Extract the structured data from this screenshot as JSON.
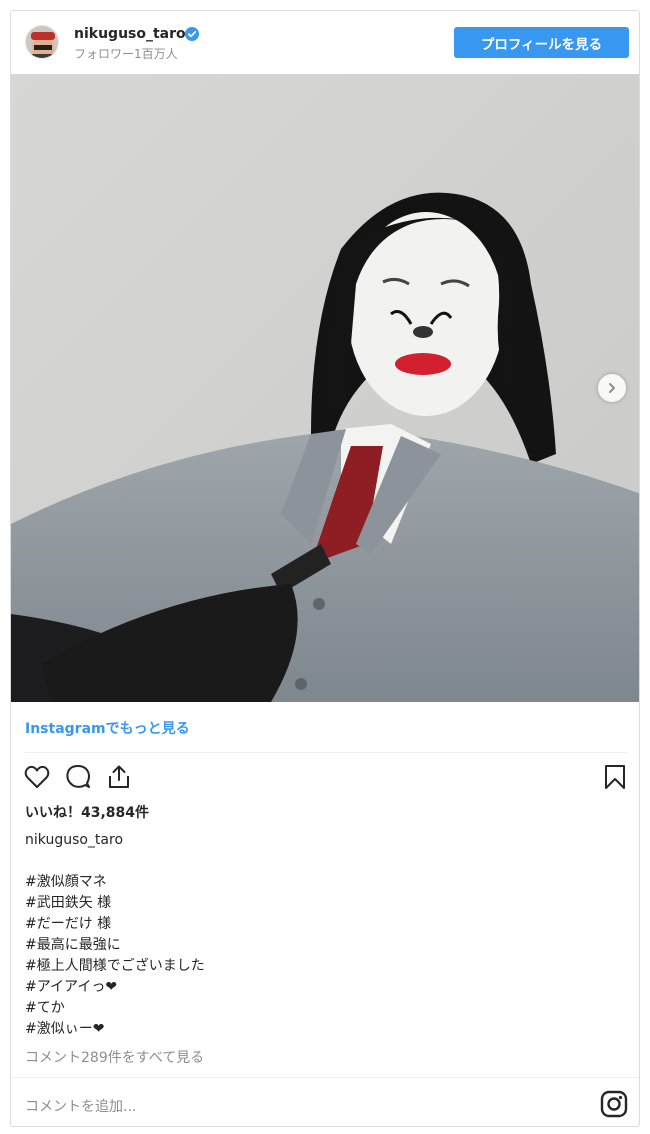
{
  "header": {
    "username": "nikuguso_taro",
    "followers": "フォロワー1百万人",
    "profile_button": "プロフィールを見る"
  },
  "photo": {
    "description_icon": "next-arrow-icon"
  },
  "more_link": "Instagramでもっと見る",
  "actions": {
    "like_icon": "heart-icon",
    "comment_icon": "comment-icon",
    "share_icon": "share-icon",
    "save_icon": "bookmark-icon"
  },
  "likes": "いいね！43,884件",
  "caption_user": "nikuguso_taro",
  "caption_lines": [
    "#激似顔マネ",
    "#武田鉄矢 様",
    "#だーだけ 様",
    "#最高に最強に",
    "#極上人間様でございました",
    "#アイアイっ❤",
    "#てか",
    "#激似ぃー❤"
  ],
  "view_comments": "コメント289件をすべて見る",
  "add_comment_placeholder": "コメントを追加...",
  "colors": {
    "accent": "#3897f0",
    "text": "#262626",
    "muted": "#8e8e8e",
    "border": "#dbdbdb"
  }
}
